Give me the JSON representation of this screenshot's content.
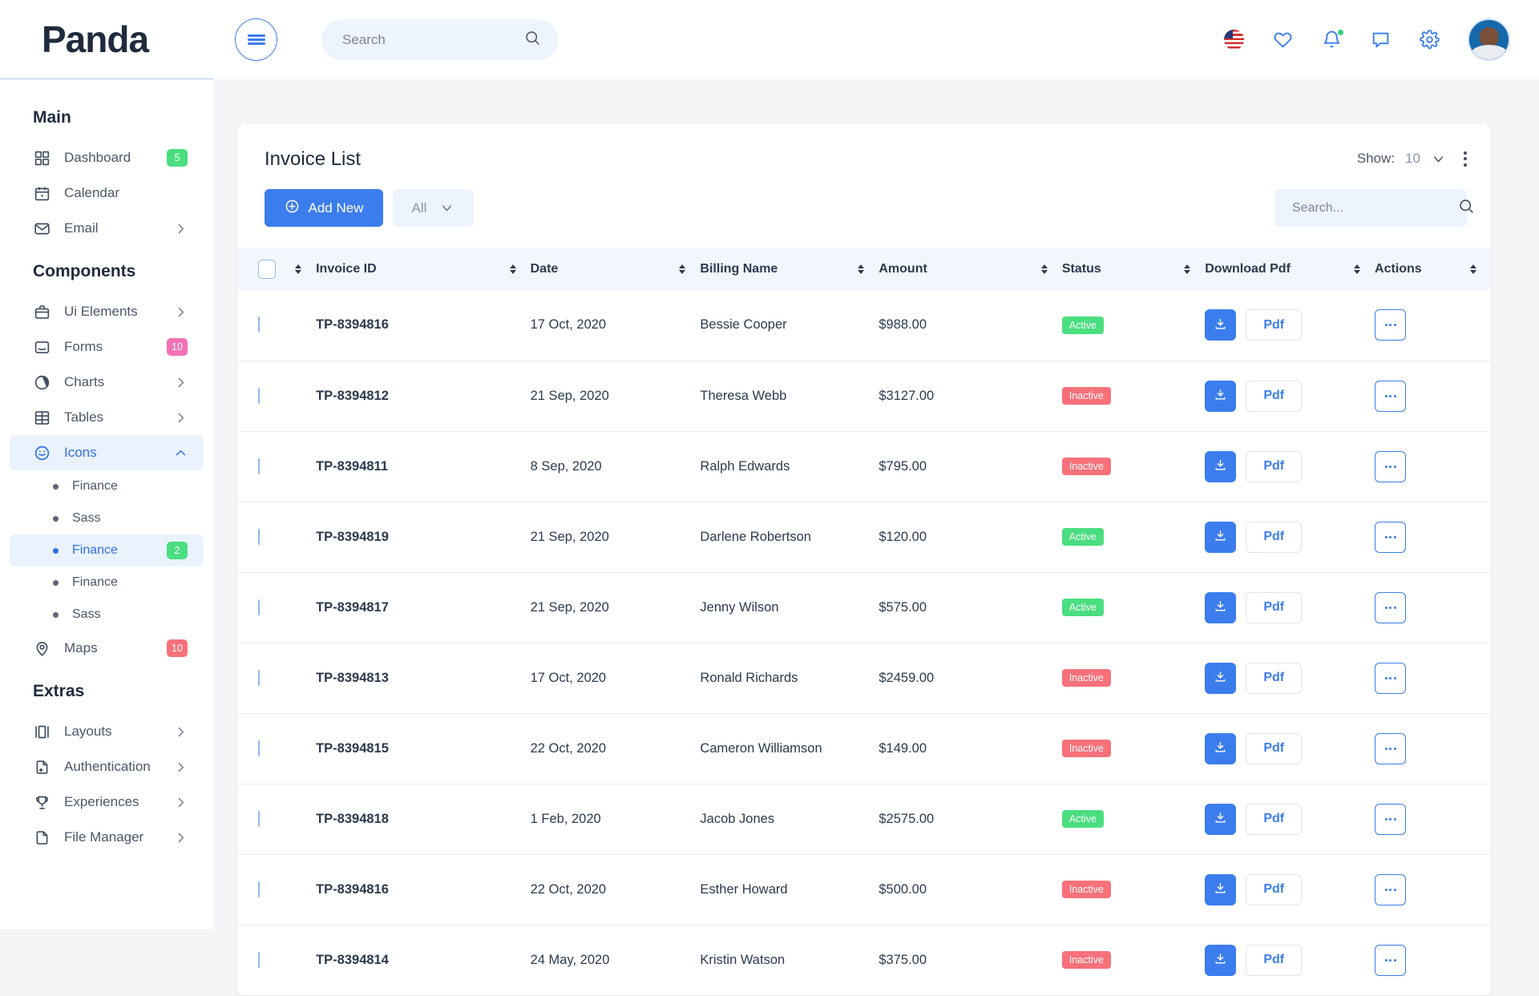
{
  "brand": {
    "name": "Panda"
  },
  "header": {
    "search": {
      "placeholder": "Search",
      "value": ""
    },
    "icons": [
      {
        "name": "flag-icon",
        "label": "US"
      },
      {
        "name": "heart-icon",
        "label": "Favorites"
      },
      {
        "name": "bell-icon",
        "label": "Notifications"
      },
      {
        "name": "chat-icon",
        "label": "Messages"
      },
      {
        "name": "gear-icon",
        "label": "Settings"
      }
    ],
    "avatar_label": "User profile"
  },
  "sidebar": {
    "sections": [
      {
        "title": "Main",
        "items": [
          {
            "label": "Dashboard",
            "icon": "grid-icon",
            "badge": "5",
            "badge_color": "#4ade80",
            "chevron": false,
            "active": false
          },
          {
            "label": "Calendar",
            "icon": "calendar-icon",
            "badge": null,
            "chevron": false,
            "active": false
          },
          {
            "label": "Email",
            "icon": "envelope-icon",
            "badge": null,
            "chevron": true,
            "active": false
          }
        ]
      },
      {
        "title": "Components",
        "items": [
          {
            "label": "Ui Elements",
            "icon": "briefcase-icon",
            "badge": null,
            "chevron": true,
            "active": false
          },
          {
            "label": "Forms",
            "icon": "form-icon",
            "badge": "10",
            "badge_color": "#f472b6",
            "chevron": false,
            "active": false
          },
          {
            "label": "Charts",
            "icon": "pie-chart-icon",
            "badge": null,
            "chevron": true,
            "active": false
          },
          {
            "label": "Tables",
            "icon": "table-icon",
            "badge": null,
            "chevron": true,
            "active": false
          },
          {
            "label": "Icons",
            "icon": "smiley-icon",
            "badge": null,
            "chevron": "up",
            "active": true,
            "children": [
              {
                "label": "Finance",
                "badge": null,
                "active": false
              },
              {
                "label": "Sass",
                "badge": null,
                "active": false
              },
              {
                "label": "Finance",
                "badge": "2",
                "badge_color": "#4ade80",
                "active": true
              },
              {
                "label": "Finance",
                "badge": null,
                "active": false
              },
              {
                "label": "Sass",
                "badge": null,
                "active": false
              }
            ]
          },
          {
            "label": "Maps",
            "icon": "map-pin-icon",
            "badge": "10",
            "badge_color": "#f8717a",
            "chevron": false,
            "active": false
          }
        ]
      },
      {
        "title": "Extras",
        "items": [
          {
            "label": "Layouts",
            "icon": "layout-icon",
            "badge": null,
            "chevron": true,
            "active": false
          },
          {
            "label": "Authentication",
            "icon": "auth-icon",
            "badge": null,
            "chevron": true,
            "active": false
          },
          {
            "label": "Experiences",
            "icon": "trophy-icon",
            "badge": null,
            "chevron": true,
            "active": false
          },
          {
            "label": "File Manager",
            "icon": "file-icon",
            "badge": null,
            "chevron": true,
            "active": false
          }
        ]
      }
    ]
  },
  "card": {
    "title": "Invoice List",
    "show": {
      "label": "Show:",
      "value": "10"
    },
    "add_new_label": "Add New",
    "filter": {
      "value": "All"
    },
    "search": {
      "placeholder": "Search...",
      "value": ""
    },
    "columns": [
      {
        "key": "checkbox",
        "label": ""
      },
      {
        "key": "invoice_id",
        "label": "Invoice ID"
      },
      {
        "key": "date",
        "label": "Date"
      },
      {
        "key": "billing_name",
        "label": "Billing Name"
      },
      {
        "key": "amount",
        "label": "Amount"
      },
      {
        "key": "status",
        "label": "Status"
      },
      {
        "key": "download_pdf",
        "label": "Download Pdf"
      },
      {
        "key": "actions",
        "label": "Actions"
      }
    ],
    "pdf_button_label": "Pdf",
    "rows": [
      {
        "invoice_id": "TP-8394816",
        "date": "17 Oct, 2020",
        "billing_name": "Bessie Cooper",
        "amount": "$988.00",
        "status": "Active"
      },
      {
        "invoice_id": "TP-8394812",
        "date": "21 Sep, 2020",
        "billing_name": "Theresa Webb",
        "amount": "$3127.00",
        "status": "Inactive"
      },
      {
        "invoice_id": "TP-8394811",
        "date": "8 Sep, 2020",
        "billing_name": "Ralph Edwards",
        "amount": "$795.00",
        "status": "Inactive"
      },
      {
        "invoice_id": "TP-8394819",
        "date": "21 Sep, 2020",
        "billing_name": "Darlene Robertson",
        "amount": "$120.00",
        "status": "Active"
      },
      {
        "invoice_id": "TP-8394817",
        "date": "21 Sep, 2020",
        "billing_name": "Jenny Wilson",
        "amount": "$575.00",
        "status": "Active"
      },
      {
        "invoice_id": "TP-8394813",
        "date": "17 Oct, 2020",
        "billing_name": "Ronald Richards",
        "amount": "$2459.00",
        "status": "Inactive"
      },
      {
        "invoice_id": "TP-8394815",
        "date": "22 Oct, 2020",
        "billing_name": "Cameron Williamson",
        "amount": "$149.00",
        "status": "Inactive"
      },
      {
        "invoice_id": "TP-8394818",
        "date": "1 Feb, 2020",
        "billing_name": "Jacob Jones",
        "amount": "$2575.00",
        "status": "Active"
      },
      {
        "invoice_id": "TP-8394816",
        "date": "22 Oct, 2020",
        "billing_name": "Esther Howard",
        "amount": "$500.00",
        "status": "Inactive"
      },
      {
        "invoice_id": "TP-8394814",
        "date": "24 May, 2020",
        "billing_name": "Kristin Watson",
        "amount": "$375.00",
        "status": "Inactive"
      }
    ]
  },
  "colors": {
    "accent": "#3b7ded",
    "active_status": "#4ade80",
    "inactive_status": "#f8717a",
    "sidebar_active_bg": "#eaf2fe",
    "page_bg": "#f4f5f7"
  }
}
